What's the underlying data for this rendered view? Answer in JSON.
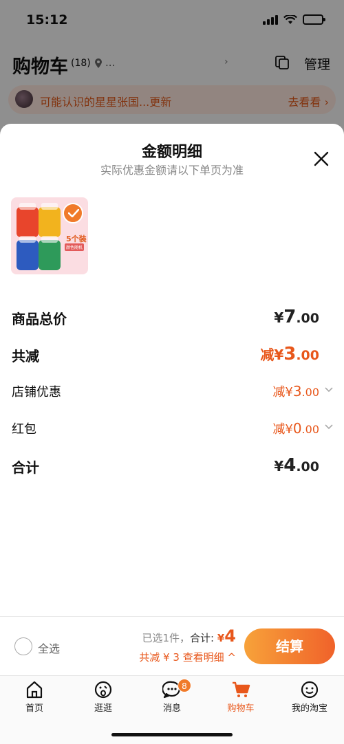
{
  "status_bar": {
    "time": "15:12",
    "battery_level": 0.35
  },
  "header": {
    "title": "购物车",
    "count": "(18)",
    "location": "...",
    "manage_label": "管理",
    "icons": [
      "location-pin-icon",
      "copy-icon"
    ]
  },
  "recommend": {
    "text": "可能认识的星星张国...更新",
    "link": "去看看 ›"
  },
  "sheet": {
    "title": "金额明细",
    "subtitle": "实际优惠金额请以下单页为准",
    "product": {
      "promo_text": "5个装",
      "promo_tag": "颜色随机",
      "checked": true
    },
    "rows": {
      "total": {
        "label": "商品总价",
        "yen": "¥",
        "int": "7",
        "dec": ".00"
      },
      "reduce": {
        "label": "共减",
        "prefix": "减",
        "yen": "¥",
        "int": "3",
        "dec": ".00"
      },
      "shop_discount": {
        "label": "店铺优惠",
        "prefix": "减",
        "yen": "¥",
        "int": "3",
        "dec": ".00"
      },
      "red_packet": {
        "label": "红包",
        "prefix": "减",
        "yen": "¥",
        "int": "0",
        "dec": ".00"
      },
      "sum": {
        "label": "合计",
        "yen": "¥",
        "int": "4",
        "dec": ".00"
      }
    }
  },
  "bottom_bar": {
    "select_all": "全选",
    "selected": "已选1件，",
    "total_label": "合计: ",
    "total_yen": "¥",
    "total_value": "4",
    "detail": "共减 ¥ 3  查看明细 ^",
    "checkout": "结算"
  },
  "tabs": [
    {
      "label": "首页",
      "icon": "home-icon"
    },
    {
      "label": "逛逛",
      "icon": "browse-icon"
    },
    {
      "label": "消息",
      "icon": "message-icon",
      "badge": "8"
    },
    {
      "label": "购物车",
      "icon": "cart-icon",
      "active": true
    },
    {
      "label": "我的淘宝",
      "icon": "profile-icon"
    }
  ],
  "colors": {
    "accent": "#e8571b",
    "checkout_start": "#f7a23a",
    "checkout_end": "#f0622a"
  }
}
